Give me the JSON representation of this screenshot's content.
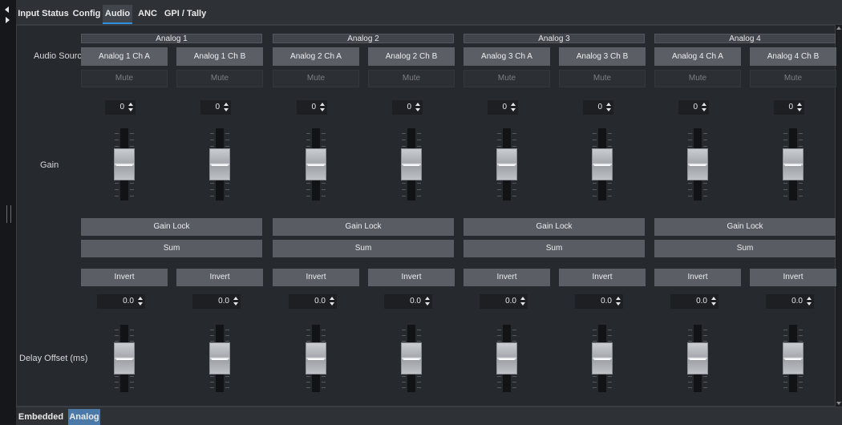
{
  "top_tabs": [
    {
      "label": "Input Status",
      "active": false
    },
    {
      "label": "Config",
      "active": false
    },
    {
      "label": "Audio",
      "active": true
    },
    {
      "label": "ANC",
      "active": false
    },
    {
      "label": "GPI / Tally",
      "active": false
    }
  ],
  "bottom_tabs": [
    {
      "label": "Embedded",
      "active": false
    },
    {
      "label": "Analog",
      "active": true
    }
  ],
  "row_labels": {
    "audio_source": "Audio Source",
    "gain": "Gain",
    "delay_offset": "Delay Offset (ms)"
  },
  "groups": [
    {
      "title": "Analog 1",
      "gain_lock": "Gain Lock",
      "sum": "Sum",
      "channels": [
        {
          "source": "Analog 1 Ch A",
          "mute": "Mute",
          "gain": "0",
          "invert": "Invert",
          "delay": "0.0",
          "gain_level": 0.5,
          "delay_level": 0.5
        },
        {
          "source": "Analog 1 Ch B",
          "mute": "Mute",
          "gain": "0",
          "invert": "Invert",
          "delay": "0.0",
          "gain_level": 0.5,
          "delay_level": 0.5
        }
      ]
    },
    {
      "title": "Analog 2",
      "gain_lock": "Gain Lock",
      "sum": "Sum",
      "channels": [
        {
          "source": "Analog 2 Ch A",
          "mute": "Mute",
          "gain": "0",
          "invert": "Invert",
          "delay": "0.0",
          "gain_level": 0.5,
          "delay_level": 0.5
        },
        {
          "source": "Analog 2 Ch B",
          "mute": "Mute",
          "gain": "0",
          "invert": "Invert",
          "delay": "0.0",
          "gain_level": 0.5,
          "delay_level": 0.5
        }
      ]
    },
    {
      "title": "Analog 3",
      "gain_lock": "Gain Lock",
      "sum": "Sum",
      "channels": [
        {
          "source": "Analog 3 Ch A",
          "mute": "Mute",
          "gain": "0",
          "invert": "Invert",
          "delay": "0.0",
          "gain_level": 0.5,
          "delay_level": 0.5
        },
        {
          "source": "Analog 3 Ch B",
          "mute": "Mute",
          "gain": "0",
          "invert": "Invert",
          "delay": "0.0",
          "gain_level": 0.5,
          "delay_level": 0.5
        }
      ]
    },
    {
      "title": "Analog 4",
      "gain_lock": "Gain Lock",
      "sum": "Sum",
      "channels": [
        {
          "source": "Analog 4 Ch A",
          "mute": "Mute",
          "gain": "0",
          "invert": "Invert",
          "delay": "0.0",
          "gain_level": 0.5,
          "delay_level": 0.5
        },
        {
          "source": "Analog 4 Ch B",
          "mute": "Mute",
          "gain": "0",
          "invert": "Invert",
          "delay": "0.0",
          "gain_level": 0.5,
          "delay_level": 0.5
        }
      ]
    }
  ],
  "colors": {
    "active_top_tab_underline": "#2f8fdc",
    "active_bottom_tab": "#4b79a8",
    "button": "#5b5f65",
    "panel": "#26292d"
  }
}
